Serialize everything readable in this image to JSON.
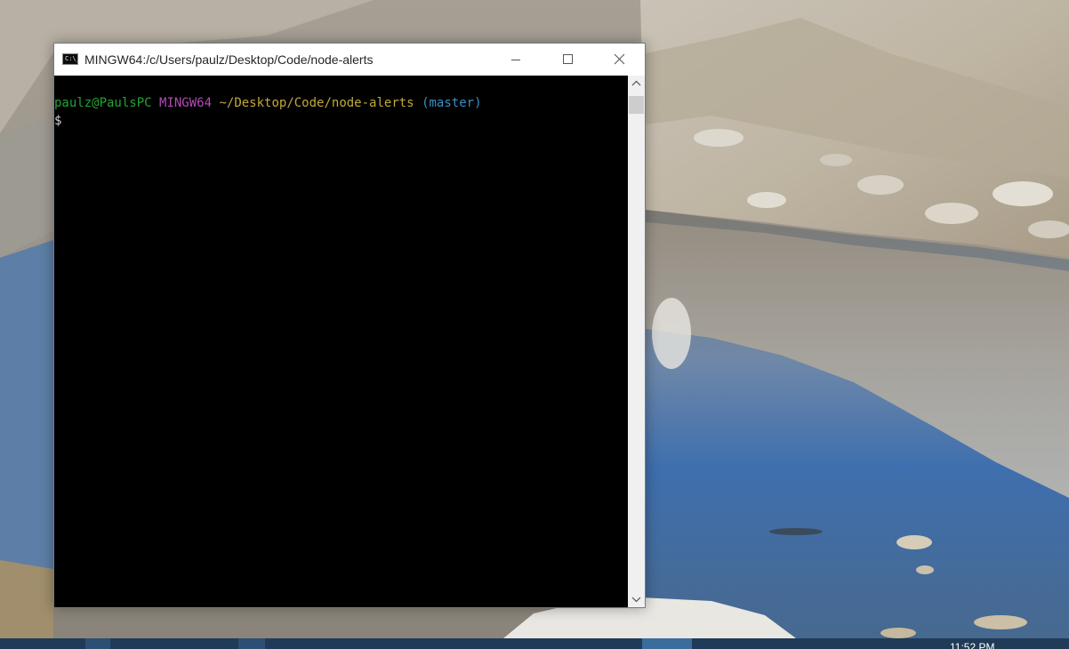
{
  "window": {
    "title": "MINGW64:/c/Users/paulz/Desktop/Code/node-alerts",
    "icon_label": "C:\\_"
  },
  "terminal": {
    "user_host": "paulz@PaulsPC",
    "system": "MINGW64",
    "path": "~/Desktop/Code/node-alerts",
    "branch": "(master)",
    "prompt": "$"
  },
  "taskbar": {
    "clock": "11:52 PM"
  },
  "colors": {
    "user_host": "#23a336",
    "system": "#b34bb5",
    "path": "#c2a93a",
    "branch": "#3a8fc5",
    "console_bg": "#000000",
    "taskbar_bg": "#1f3b57"
  },
  "icons": {
    "app": "console-icon",
    "minimize": "minimize-icon",
    "maximize": "maximize-icon",
    "close": "close-icon",
    "scroll_up": "chevron-up-icon",
    "scroll_down": "chevron-down-icon"
  }
}
